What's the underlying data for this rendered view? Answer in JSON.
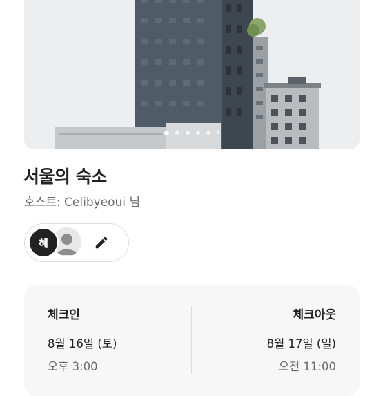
{
  "listing": {
    "title": "서울의 숙소",
    "host_line": "호스트: Celibyeoui 님"
  },
  "photo_carousel": {
    "slide_count": 6,
    "active_index": 0
  },
  "guests": {
    "initial": "혜"
  },
  "icons": {
    "edit": "pencil-icon",
    "avatar_placeholder": "person-icon"
  },
  "reservation": {
    "checkin": {
      "label": "체크인",
      "date": "8월 16일 (토)",
      "time": "오후 3:00"
    },
    "checkout": {
      "label": "체크아웃",
      "date": "8월 17일 (일)",
      "time": "오전 11:00"
    }
  }
}
